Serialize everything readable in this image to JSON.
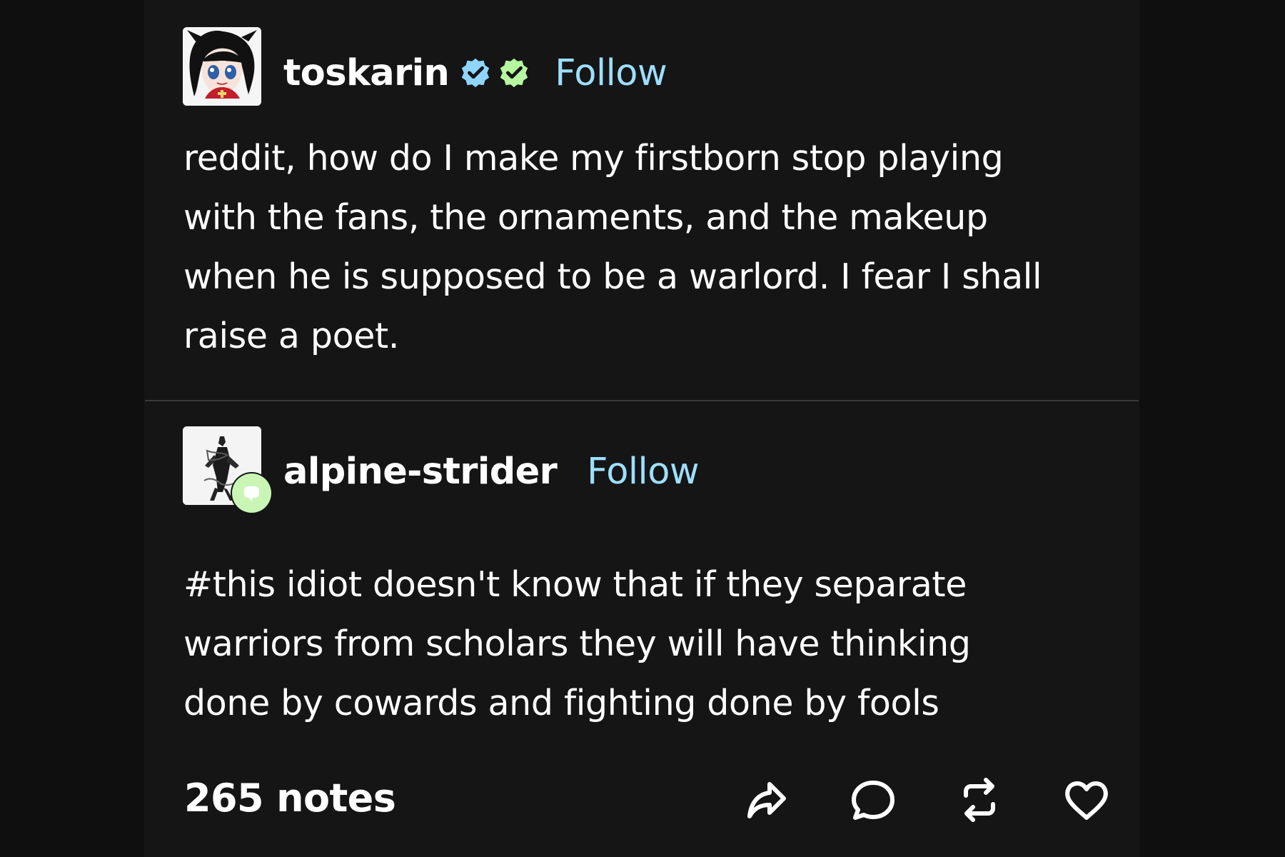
{
  "posts": [
    {
      "username": "toskarin",
      "follow_label": "Follow",
      "text_lines": [
        "reddit, how do I make my firstborn stop playing",
        "with the fans, the ornaments, and the makeup",
        "when he is supposed to be a warlord. I fear I shall",
        "raise a poet."
      ]
    },
    {
      "username": "alpine-strider",
      "follow_label": "Follow",
      "text_lines": [
        "#this idiot doesn't know that if they separate",
        "warriors from scholars they will have thinking",
        "done by cowards and fighting done by fools"
      ]
    }
  ],
  "footer": {
    "notes_label": "265 notes",
    "actions": [
      {
        "icon": "share-icon"
      },
      {
        "icon": "reply-icon"
      },
      {
        "icon": "reblog-icon"
      },
      {
        "icon": "like-icon"
      }
    ]
  },
  "colors": {
    "background": "#151515",
    "text": "#ffffff",
    "follow": "#9ddfff",
    "badge_blue": "#8fd6ff",
    "badge_green": "#b7f7a0"
  }
}
